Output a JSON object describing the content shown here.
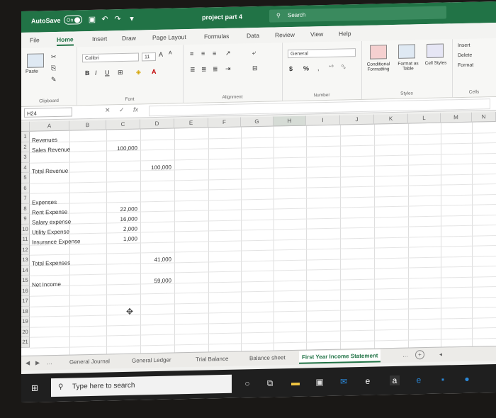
{
  "titlebar": {
    "autosave_label": "AutoSave",
    "autosave_state": "On",
    "document_title": "project part 4",
    "search_placeholder": "Search"
  },
  "menu": [
    "File",
    "Home",
    "Insert",
    "Draw",
    "Page Layout",
    "Formulas",
    "Data",
    "Review",
    "View",
    "Help"
  ],
  "ribbon": {
    "paste_label": "Paste",
    "font_name": "Calibri",
    "font_size": "11",
    "number_format": "General",
    "bold": "B",
    "italic": "I",
    "underline": "U",
    "currency": "$",
    "percent": "%",
    "conditional_formatting": "Conditional Formatting",
    "format_as_table": "Format as Table",
    "cell_styles": "Cell Styles",
    "insert": "Insert",
    "delete": "Delete",
    "format": "Format",
    "groups": {
      "clipboard": "Clipboard",
      "font": "Font",
      "alignment": "Alignment",
      "number": "Number",
      "styles": "Styles",
      "cells": "Cells"
    }
  },
  "formula_bar": {
    "name_box": "H24",
    "fx": "fx"
  },
  "columns": [
    "A",
    "B",
    "C",
    "D",
    "E",
    "F",
    "G",
    "H",
    "I",
    "J",
    "K",
    "L",
    "M",
    "N"
  ],
  "rows": [
    "1",
    "2",
    "3",
    "4",
    "5",
    "6",
    "7",
    "8",
    "9",
    "10",
    "11",
    "12",
    "13",
    "14",
    "15",
    "16",
    "17",
    "18",
    "19",
    "20",
    "21"
  ],
  "cells": {
    "a1": "Revenues",
    "a2": "Sales Revenue",
    "c2": "100,000",
    "a4": "Total Revenue",
    "d4": "100,000",
    "a7": "Expenses",
    "a8": "Rent Expense",
    "c8": "22,000",
    "a9": "Salary expense",
    "c9": "16,000",
    "a10": "Utility Expense",
    "c10": "2,000",
    "a11": "Insurance Expense",
    "c11": "1,000",
    "a13": "Total Expenses",
    "d13": "41,000",
    "a15": "Net Income",
    "d15": "59,000"
  },
  "sheets": [
    "General Journal",
    "General Ledger",
    "Trial Balance",
    "Balance sheet",
    "First Year Income Statement"
  ],
  "active_sheet": "First Year Income Statement",
  "taskbar": {
    "search_placeholder": "Type here to search"
  },
  "colors": {
    "excel_green": "#217346"
  }
}
